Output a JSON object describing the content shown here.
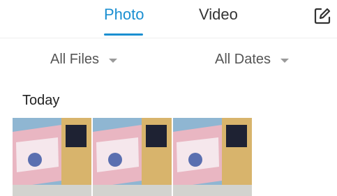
{
  "tabs": [
    {
      "label": "Photo",
      "active": true
    },
    {
      "label": "Video",
      "active": false
    }
  ],
  "header": {
    "edit_icon": "edit-icon"
  },
  "filters": {
    "files_label": "All Files",
    "dates_label": "All Dates"
  },
  "section": {
    "title": "Today"
  },
  "photos": {
    "count": 3
  },
  "colors": {
    "accent": "#1b8fd1",
    "text": "#333333",
    "muted": "#9a9a9a"
  }
}
